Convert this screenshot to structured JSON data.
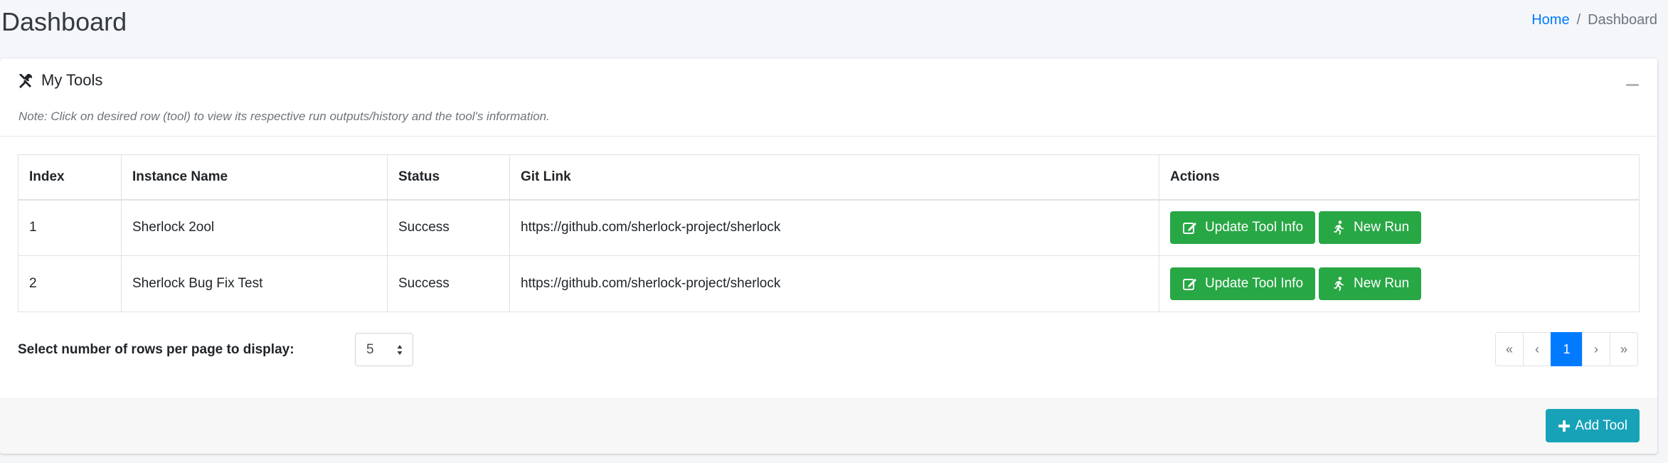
{
  "header": {
    "title": "Dashboard",
    "breadcrumb": [
      {
        "label": "Home"
      },
      {
        "label": "Dashboard"
      }
    ],
    "breadcrumb_separator": "/"
  },
  "card": {
    "title": "My Tools",
    "title_icon": "tools-icon",
    "note": "Note: Click on desired row (tool) to view its respective run outputs/history and the tool's information.",
    "table": {
      "columns": [
        "Index",
        "Instance Name",
        "Status",
        "Git Link",
        "Actions"
      ],
      "rows": [
        {
          "index": "1",
          "name": "Sherlock 2ool",
          "status": "Success",
          "git": "https://github.com/sherlock-project/sherlock"
        },
        {
          "index": "2",
          "name": "Sherlock Bug Fix Test",
          "status": "Success",
          "git": "https://github.com/sherlock-project/sherlock"
        }
      ],
      "actions": {
        "update_label": "Update Tool Info",
        "update_icon": "edit-icon",
        "run_label": "New Run",
        "run_icon": "running-icon"
      }
    },
    "rows_per_page": {
      "label": "Select number of rows per page to display:",
      "value": "5"
    },
    "pagination": {
      "first": "«",
      "prev": "‹",
      "current": "1",
      "next": "›",
      "last": "»"
    },
    "footer": {
      "add_label": "Add Tool",
      "add_icon": "plus-icon"
    }
  },
  "colors": {
    "primary": "#007bff",
    "success": "#28a745",
    "info": "#17a2b8",
    "background": "#f4f6f9"
  }
}
